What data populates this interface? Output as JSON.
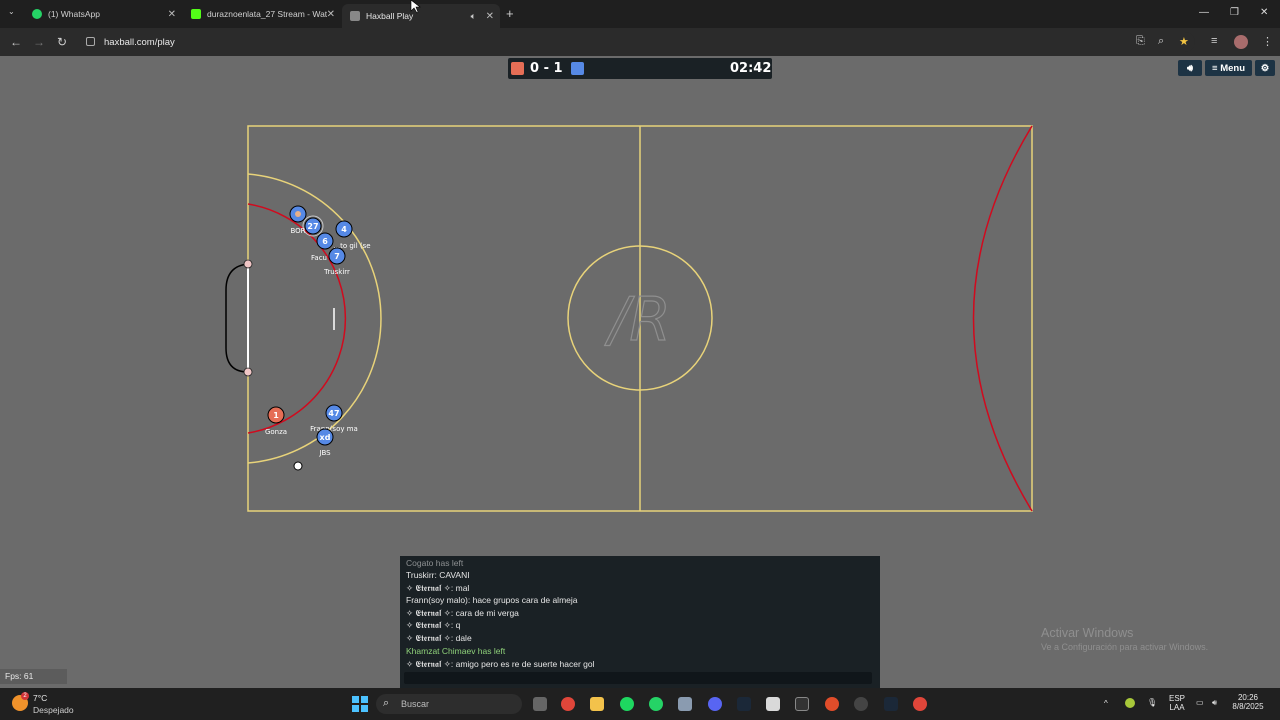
{
  "browser": {
    "tabs": [
      {
        "title": "(1) WhatsApp",
        "color": "#25d366"
      },
      {
        "title": "duraznoenlata_27 Stream - Wat",
        "color": "#53fc18"
      },
      {
        "title": "Haxball Play",
        "color": "#888888"
      }
    ],
    "url": "haxball.com/play"
  },
  "game": {
    "score_red": "0",
    "score_sep": "-",
    "score_blue": "1",
    "clock": "02:42",
    "menu_label": "Menu",
    "center_logo": "/R",
    "colors": {
      "red_team": "#e56e56",
      "blue_team": "#5689e5",
      "line": "#e8d37a",
      "red_line": "#d10a1e"
    },
    "players": [
      {
        "num": "1",
        "name": "Gonza",
        "team": "red"
      },
      {
        "num": "47",
        "name": "Frann(soy ma",
        "team": "blue"
      },
      {
        "num": "xd",
        "name": "JBS",
        "team": "blue"
      },
      {
        "num": "27",
        "name": "BOR",
        "team": "blue"
      },
      {
        "num": "4",
        "name": "...to gil (se",
        "team": "blue"
      },
      {
        "num": "6",
        "name": "Facu",
        "team": "blue"
      },
      {
        "num": "7",
        "name": "Truskirr",
        "team": "blue"
      },
      {
        "num": "",
        "name": "",
        "team": "blue"
      }
    ]
  },
  "chat": {
    "lines": [
      {
        "text": "Cogato has left",
        "color": "#e6e6e6"
      },
      {
        "text": "Truskirr: CAVANI",
        "color": "#e6e6e6"
      },
      {
        "text": "✧ 𝕰𝖙𝖊𝖗𝖓𝖆𝖑 ✧: mal",
        "color": "#e6e6e6"
      },
      {
        "text": "Frann(soy malo): hace grupos cara de almeja",
        "color": "#e6e6e6"
      },
      {
        "text": "✧ 𝕰𝖙𝖊𝖗𝖓𝖆𝖑 ✧: cara de mi verga",
        "color": "#e6e6e6"
      },
      {
        "text": "✧ 𝕰𝖙𝖊𝖗𝖓𝖆𝖑 ✧: q",
        "color": "#e6e6e6"
      },
      {
        "text": "✧ 𝕰𝖙𝖊𝖗𝖓𝖆𝖑 ✧: dale",
        "color": "#e6e6e6"
      },
      {
        "text": "Khamzat Chimaev has left",
        "color": "#8fd17a"
      },
      {
        "text": "✧ 𝕰𝖙𝖊𝖗𝖓𝖆𝖑 ✧: amigo pero es re de suerte hacer gol",
        "color": "#e6e6e6"
      }
    ]
  },
  "fps": "Fps: 61",
  "watermark": {
    "title": "Activar Windows",
    "subtitle": "Ve a Configuración para activar Windows."
  },
  "taskbar": {
    "weather_temp": "7°C",
    "weather_desc": "Despejado",
    "weather_badge": "2",
    "search_placeholder": "Buscar",
    "lang_top": "ESP",
    "lang_bottom": "LAA",
    "time": "20:26",
    "date": "8/8/2025"
  }
}
